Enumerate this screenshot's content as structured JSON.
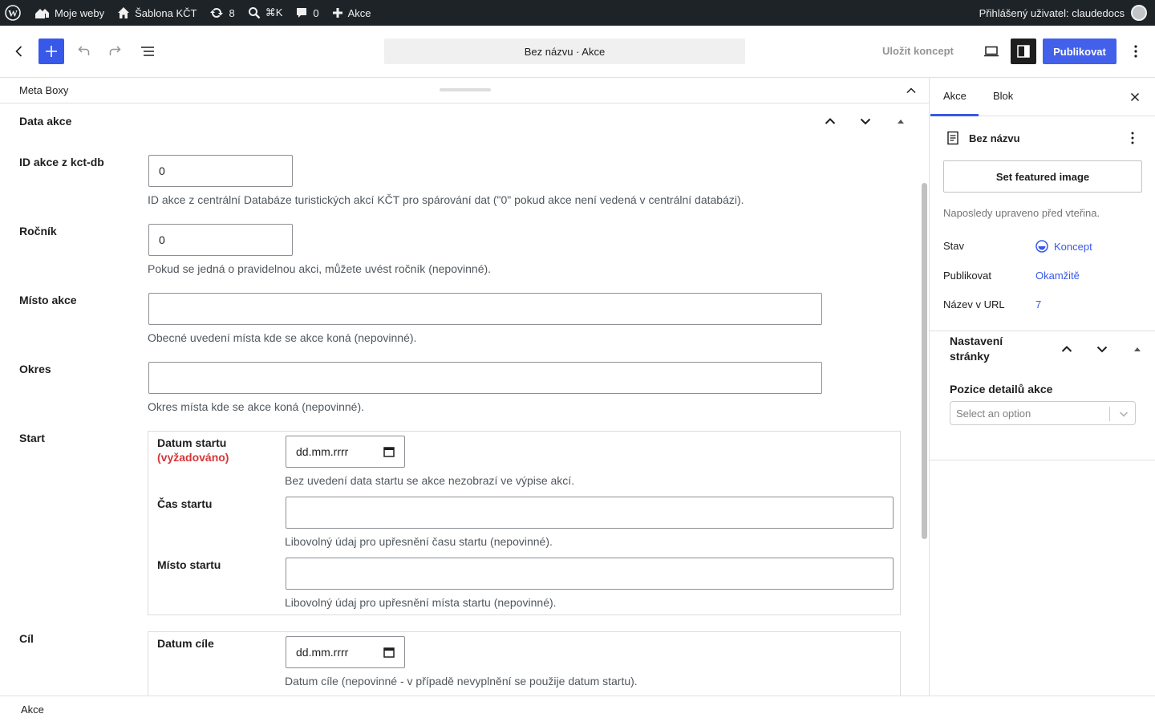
{
  "adminbar": {
    "site": "Moje weby",
    "template": "Šablona KČT",
    "updates": "8",
    "search": "⌘K",
    "comments": "0",
    "new": "Akce",
    "user": "Přihlášený uživatel: claudedocs"
  },
  "topbar": {
    "title": "Bez názvu · Akce",
    "save_draft": "Uložit koncept",
    "publish": "Publikovat"
  },
  "meta": {
    "bar_label": "Meta Boxy",
    "box_title": "Data akce"
  },
  "fields": {
    "id": {
      "label": "ID akce z kct-db",
      "value": "0",
      "help": "ID akce z centrální Databáze turistických akcí KČT pro spárování dat (\"0\" pokud akce není vedená v centrální databázi)."
    },
    "rocnik": {
      "label": "Ročník",
      "value": "0",
      "help": "Pokud se jedná o pravidelnou akci, můžete uvést ročník (nepovinné)."
    },
    "misto": {
      "label": "Místo akce",
      "value": "",
      "help": "Obecné uvedení místa kde se akce koná (nepovinné)."
    },
    "okres": {
      "label": "Okres",
      "value": "",
      "help": "Okres místa kde se akce koná (nepovinné)."
    },
    "start": {
      "label": "Start",
      "datum_label": "Datum startu",
      "required": "(vyžadováno)",
      "datum_value": "dd.mm.rrrr",
      "datum_help": "Bez uvedení data startu se akce nezobrazí ve výpise akcí.",
      "cas_label": "Čas startu",
      "cas_help": "Libovolný údaj pro upřesnění času startu (nepovinné).",
      "misto_label": "Místo startu",
      "misto_help": "Libovolný údaj pro upřesnění místa startu (nepovinné)."
    },
    "cil": {
      "label": "Cíl",
      "datum_label": "Datum cíle",
      "datum_value": "dd.mm.rrrr",
      "datum_help": "Datum cíle (nepovinné - v případě nevyplnění se použije datum startu)."
    }
  },
  "sidebar": {
    "tab_post": "Akce",
    "tab_block": "Blok",
    "post_title": "Bez názvu",
    "featured": "Set featured image",
    "modified": "Naposledy upraveno před vteřina.",
    "status_label": "Stav",
    "status_value": "Koncept",
    "publish_label": "Publikovat",
    "publish_value": "Okamžitě",
    "url_label": "Název v URL",
    "url_value": "7",
    "panel_title_1": "Nastavení",
    "panel_title_2": "stránky",
    "position_label": "Pozice detailů akce",
    "select_placeholder": "Select an option"
  },
  "footer": {
    "breadcrumb": "Akce"
  },
  "colors": {
    "accent": "#3858e9",
    "adminbar": "#1d2327",
    "required": "#d63638"
  }
}
